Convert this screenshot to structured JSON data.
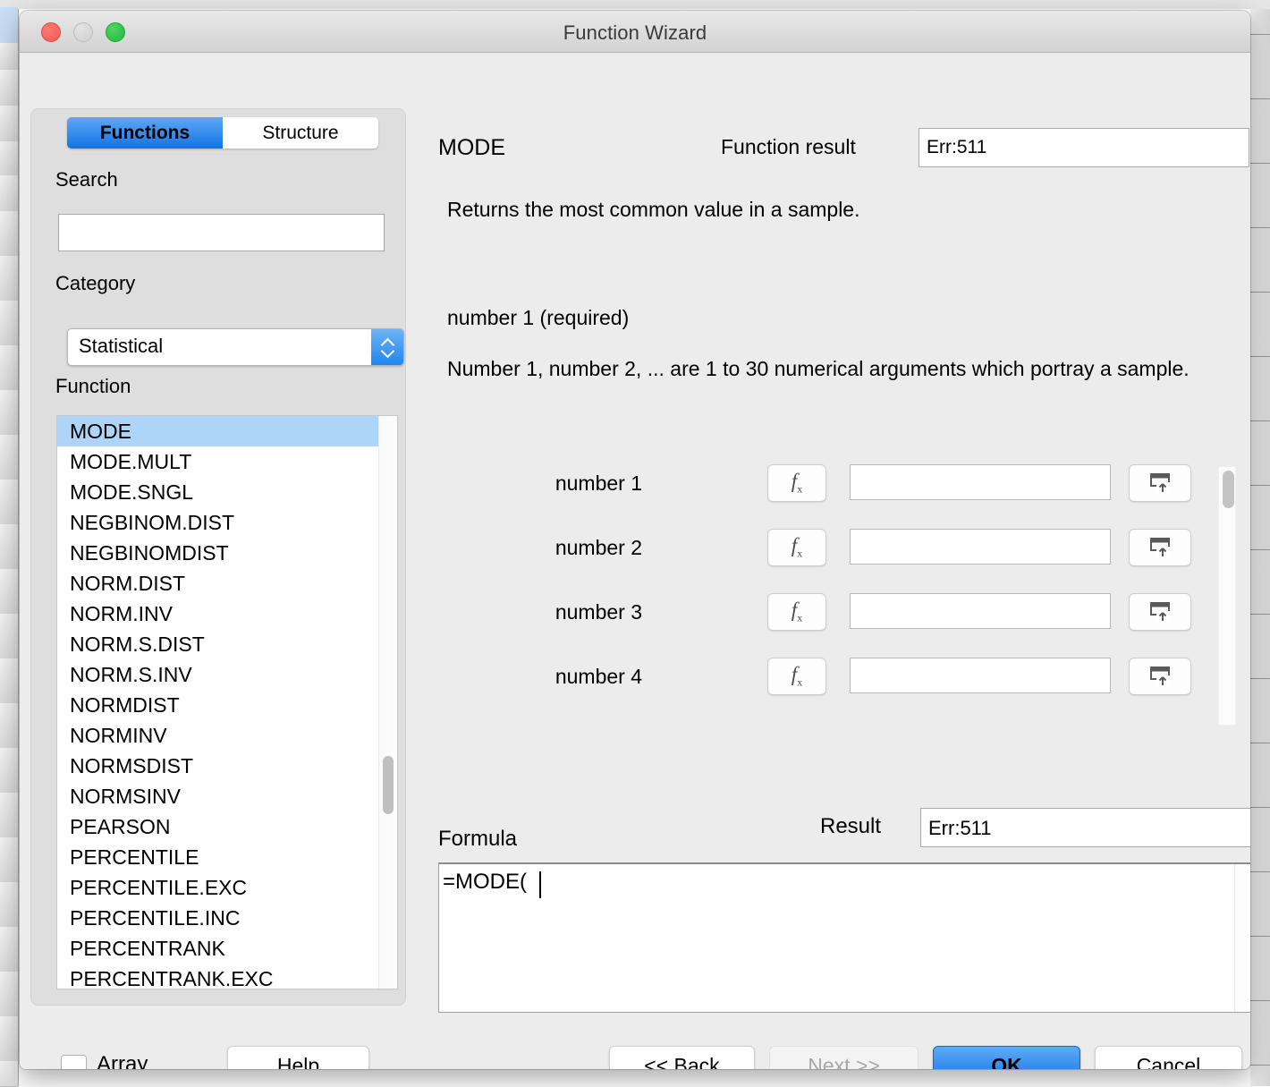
{
  "window": {
    "title": "Function Wizard",
    "controls": {
      "close": "close-button",
      "minimize": "minimize-button",
      "zoom": "zoom-button"
    }
  },
  "tabs": [
    {
      "label": "Functions",
      "active": true
    },
    {
      "label": "Structure",
      "active": false
    }
  ],
  "left_panel": {
    "search": {
      "label": "Search",
      "value": "",
      "placeholder": ""
    },
    "category": {
      "label": "Category",
      "selected": "Statistical"
    },
    "function": {
      "label": "Function",
      "selected": "MODE",
      "items": [
        "MODE",
        "MODE.MULT",
        "MODE.SNGL",
        "NEGBINOM.DIST",
        "NEGBINOMDIST",
        "NORM.DIST",
        "NORM.INV",
        "NORM.S.DIST",
        "NORM.S.INV",
        "NORMDIST",
        "NORMINV",
        "NORMSDIST",
        "NORMSINV",
        "PEARSON",
        "PERCENTILE",
        "PERCENTILE.EXC",
        "PERCENTILE.INC",
        "PERCENTRANK",
        "PERCENTRANK.EXC"
      ]
    }
  },
  "right_panel": {
    "function_name": "MODE",
    "function_result_label": "Function result",
    "function_result_value": "Err:511",
    "description": "Returns the most common value in a sample.",
    "argument_title": "number 1 (required)",
    "argument_description": "Number 1, number 2, ... are 1 to 30 numerical arguments which portray a sample.",
    "arguments": [
      {
        "label": "number 1",
        "value": "",
        "fx": "f",
        "fx_sub": "x"
      },
      {
        "label": "number 2",
        "value": "",
        "fx": "f",
        "fx_sub": "x"
      },
      {
        "label": "number 3",
        "value": "",
        "fx": "f",
        "fx_sub": "x"
      },
      {
        "label": "number 4",
        "value": "",
        "fx": "f",
        "fx_sub": "x"
      }
    ]
  },
  "formula_area": {
    "formula_label": "Formula",
    "result_label": "Result",
    "result_value": "Err:511",
    "formula_text": "=MODE("
  },
  "footer": {
    "array_label": "Array",
    "array_checked": false,
    "help_label": "Help",
    "back_label": "<< Back",
    "next_label": "Next >>",
    "ok_label": "OK",
    "cancel_label": "Cancel"
  },
  "colors": {
    "accent_blue": "#1273e6",
    "selection_blue": "#aed4f7",
    "dialog_bg": "#ececec",
    "panel_bg": "#dedede"
  }
}
